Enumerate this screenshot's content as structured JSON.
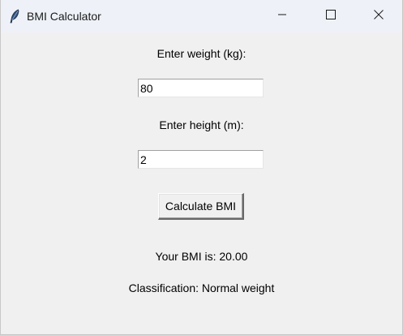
{
  "window": {
    "title": "BMI Calculator",
    "icon": "feather-icon",
    "controls": {
      "minimize": "minimize-icon",
      "maximize": "maximize-icon",
      "close": "close-icon"
    }
  },
  "form": {
    "weight_label": "Enter weight (kg):",
    "weight_value": "80",
    "height_label": "Enter height (m):",
    "height_value": "2",
    "calculate_label": "Calculate BMI"
  },
  "result": {
    "bmi_text": "Your BMI is: 20.00",
    "classification_text": "Classification: Normal weight"
  }
}
